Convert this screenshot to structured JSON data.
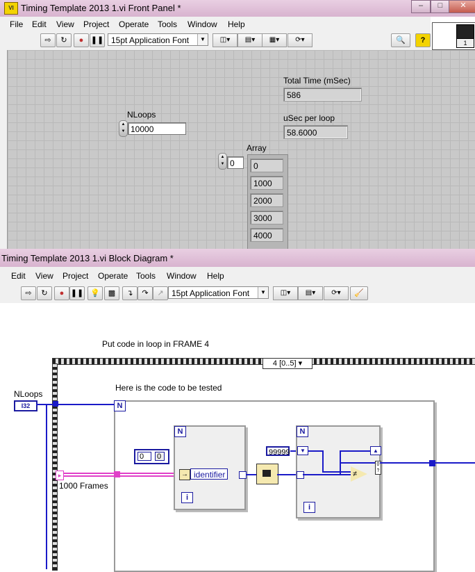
{
  "front_panel": {
    "title": "Timing Template 2013 1.vi Front Panel *",
    "menu": [
      "File",
      "Edit",
      "View",
      "Project",
      "Operate",
      "Tools",
      "Window",
      "Help"
    ],
    "font_selector": "15pt Application Font",
    "controls": {
      "nloops": {
        "label": "NLoops",
        "value": "10000"
      },
      "total_time": {
        "label": "Total Time (mSec)",
        "value": "586"
      },
      "usec_per_loop": {
        "label": "uSec per loop",
        "value": "58.6000"
      },
      "array": {
        "label": "Array",
        "index": "0",
        "elements": [
          "0",
          "1000",
          "2000",
          "3000",
          "4000"
        ]
      }
    },
    "connector_pane_number": "1"
  },
  "block_diagram": {
    "title": "Timing Template 2013 1.vi Block Diagram *",
    "menu": [
      "Edit",
      "View",
      "Project",
      "Operate",
      "Tools",
      "Window",
      "Help"
    ],
    "font_selector": "15pt Application Font",
    "comments": {
      "frame_note": "Put code in loop in FRAME 4",
      "code_note": "Here is the code to be tested"
    },
    "sequence_selector": "4 [0..5]",
    "nloops_terminal": {
      "label": "NLoops",
      "type": "I32"
    },
    "frames_label": "1000 Frames",
    "array_const_index": "0",
    "array_const_value": "0",
    "identifier_label": "identifier",
    "numeric_const": "99999",
    "loop_letter_n": "N",
    "loop_letter_i": "i"
  },
  "colors": {
    "title_bar": "#d8b3cf",
    "panel_grid": "#c9c9c9",
    "wire_int": "#1a1ac8",
    "wire_string": "#e040c8"
  }
}
